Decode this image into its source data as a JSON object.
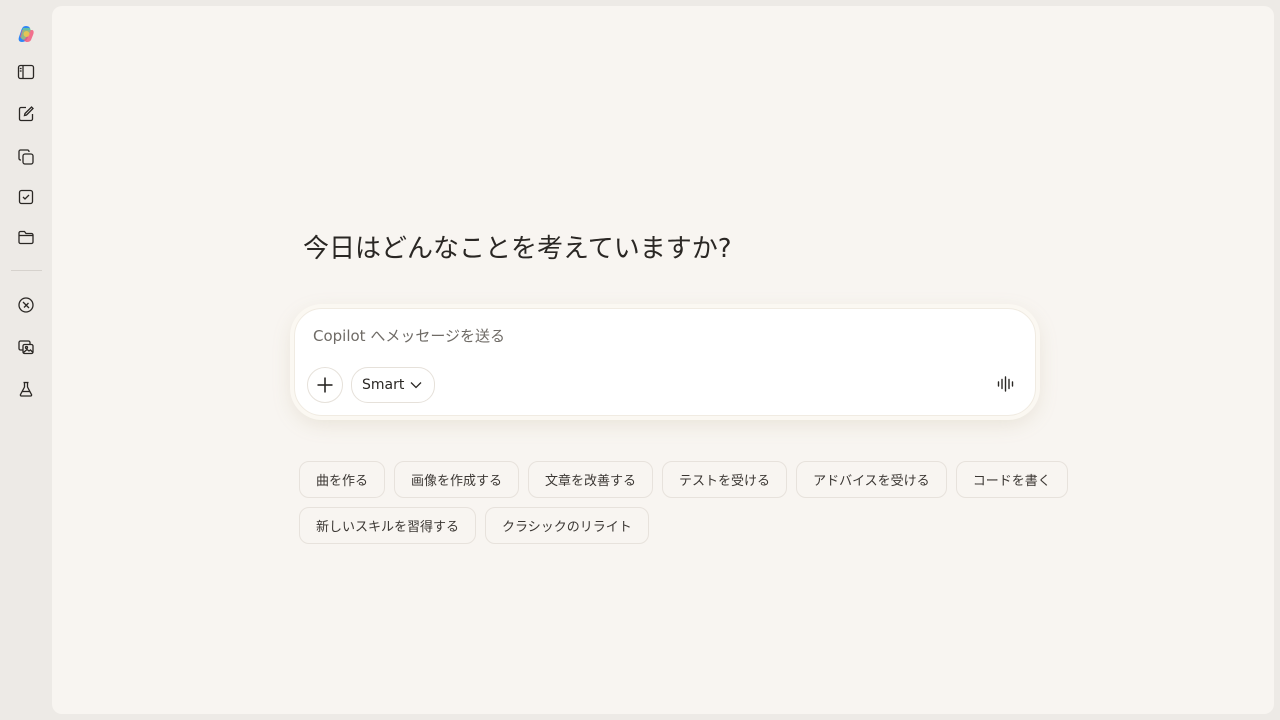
{
  "sidebar": {
    "icons": [
      {
        "name": "copilot-logo-icon"
      },
      {
        "name": "sidebar-toggle-icon"
      },
      {
        "name": "new-chat-icon"
      },
      {
        "name": "pages-icon"
      },
      {
        "name": "tasks-icon"
      },
      {
        "name": "folder-icon"
      },
      {
        "name": "discover-icon"
      },
      {
        "name": "image-gallery-icon"
      },
      {
        "name": "labs-flask-icon"
      }
    ]
  },
  "main": {
    "heading": "今日はどんなことを考えていますか?"
  },
  "composer": {
    "placeholder": "Copilot へメッセージを送る",
    "value": "",
    "mode_label": "Smart"
  },
  "suggestions": {
    "row1": [
      "曲を作る",
      "画像を作成する",
      "文章を改善する",
      "テストを受ける",
      "アドバイスを受ける",
      "コードを書く"
    ],
    "row2": [
      "新しいスキルを習得する",
      "クラシックのリライト"
    ]
  },
  "colors": {
    "page_bg": "#f8f5f1",
    "sidebar_bg": "#edeae6",
    "composer_bg": "#ffffff",
    "text": "#2a2724"
  }
}
